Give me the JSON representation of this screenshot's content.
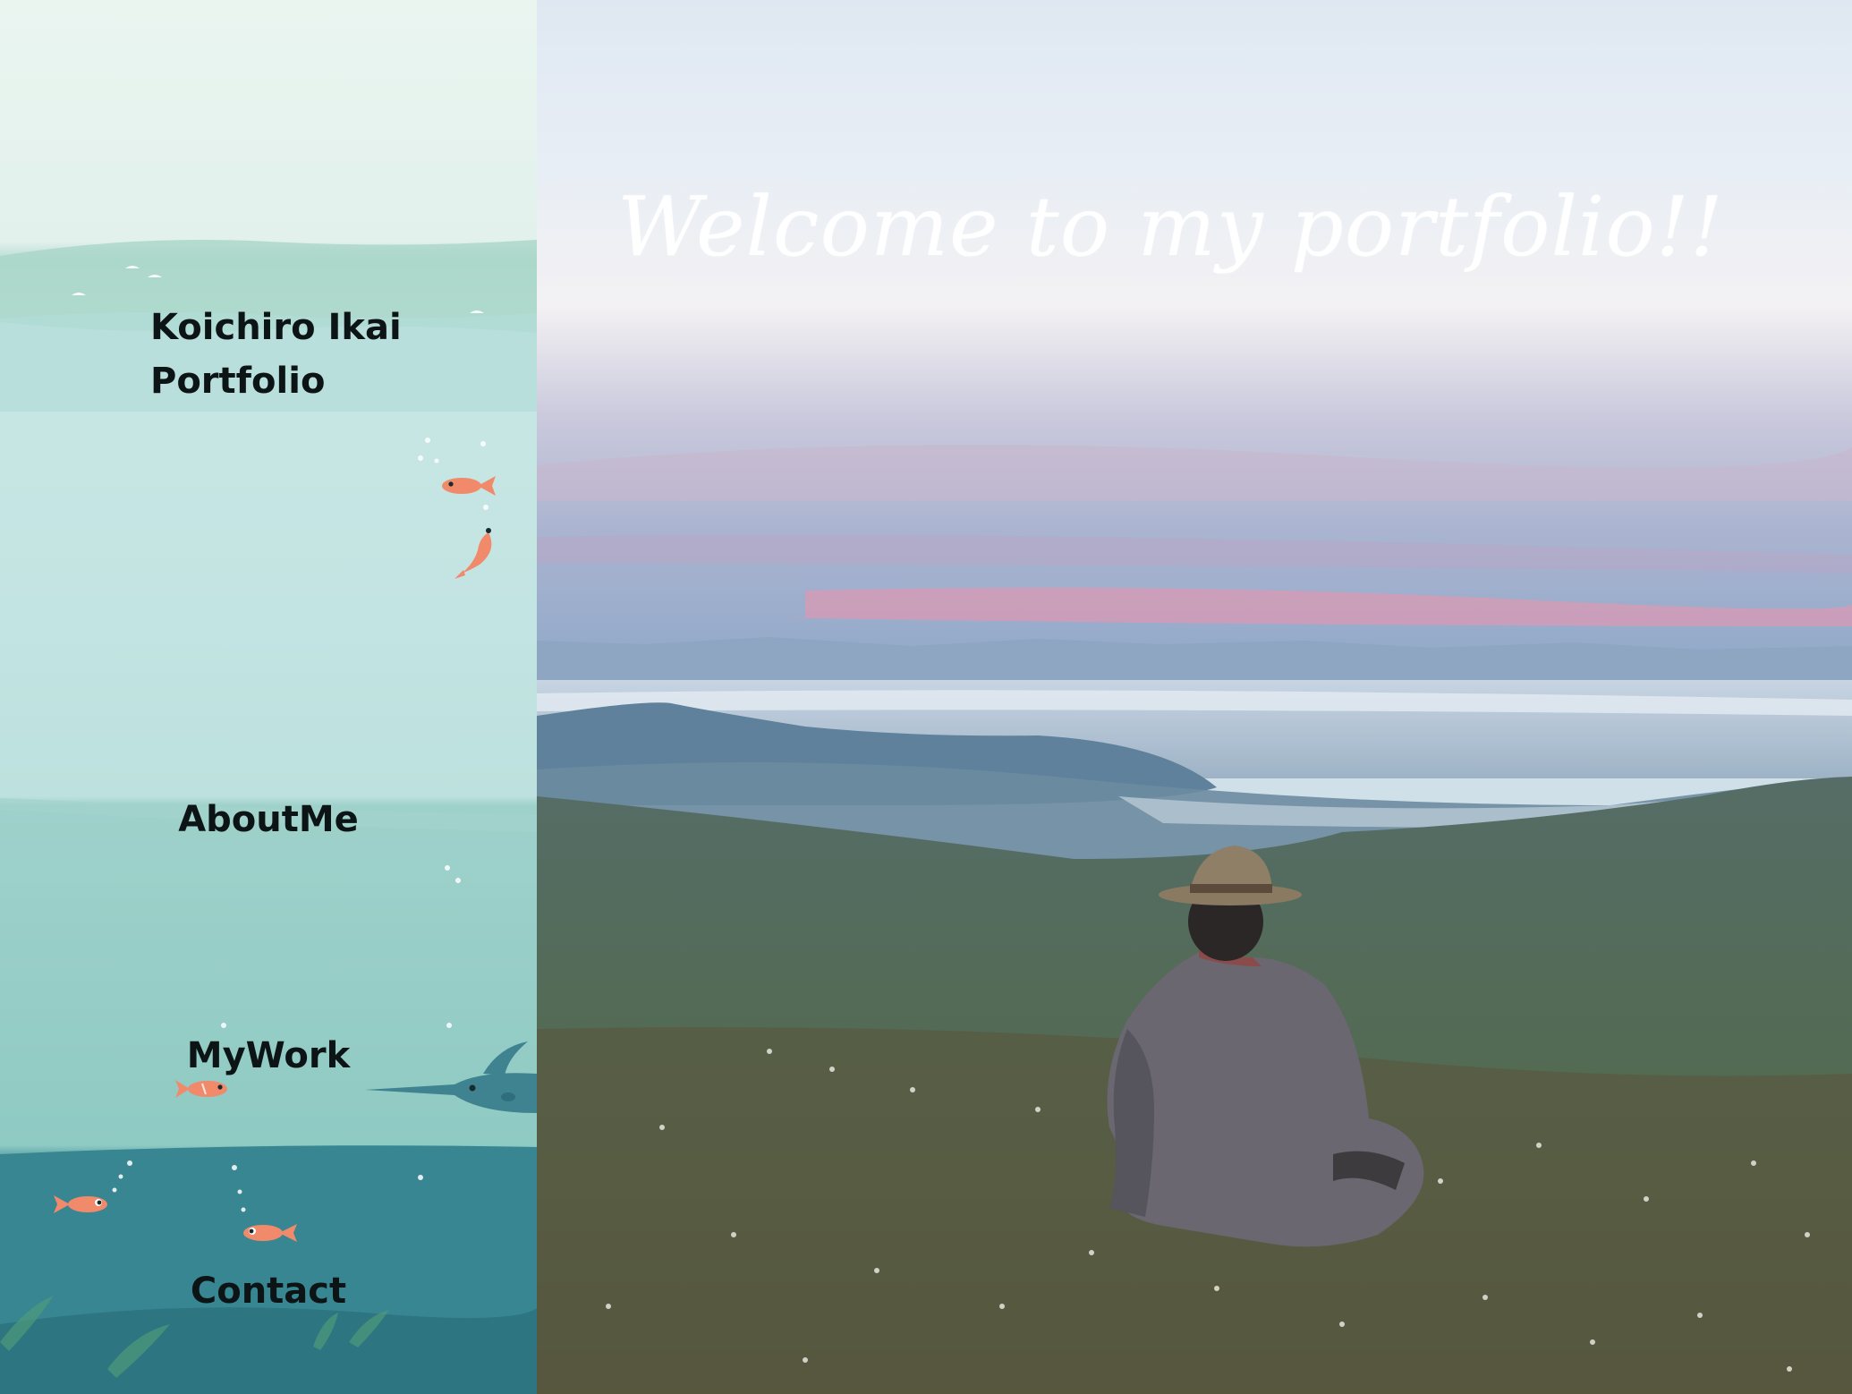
{
  "sidebar": {
    "brand_line1": "Koichiro Ikai",
    "brand_line2": "Portfolio",
    "nav": {
      "about": "AboutMe",
      "work": "MyWork",
      "contact": "Contact"
    },
    "colors": {
      "sky": "#eaf5f0",
      "sea_light": "#c2e4e2",
      "sea_mid": "#8fcac3",
      "sea_deep": "#32818c",
      "fish": "#f08a6b",
      "swordfish": "#3f8391"
    }
  },
  "hero": {
    "title": "Welcome to my portfolio!!",
    "title_color": "#ffffff",
    "scene": "person in hat sitting on grassy hill overlooking misty valley at dusk"
  }
}
